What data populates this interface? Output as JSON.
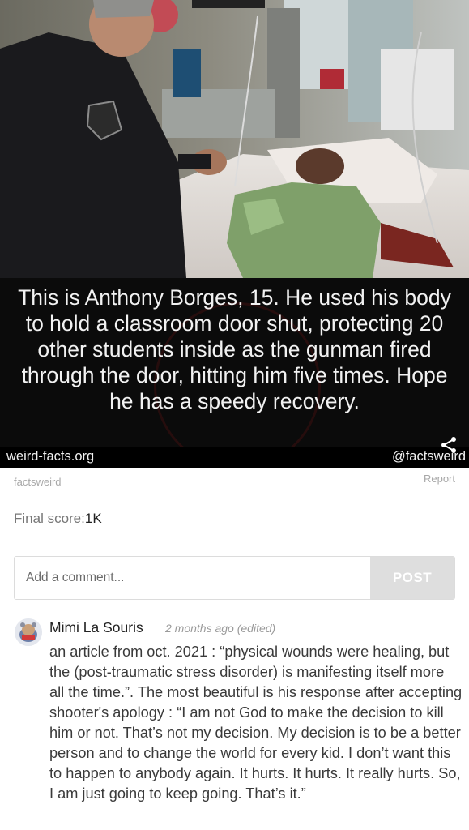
{
  "meme": {
    "caption": "This is Anthony Borges, 15. He used his body to hold a classroom door shut, protecting 20 other students inside as the gunman fired through the door, hitting him five times. Hope he has a speedy recovery.",
    "site": "weird-facts.org",
    "handle": "@factsweird",
    "share_icon": "share-icon"
  },
  "post": {
    "author": "factsweird",
    "report_label": "Report",
    "score_label": "Final score:",
    "score_value": "1K"
  },
  "comment_form": {
    "placeholder": "Add a comment...",
    "post_label": "POST"
  },
  "comments": [
    {
      "user": "Mimi La Souris",
      "time": "2 months ago (edited)",
      "text": "an article from oct. 2021 : “physical wounds were healing, but the (post-traumatic stress disorder) is manifesting itself more all the time.”. The most beautiful is his response after accepting shooter's apology : “I am not God to make the decision to kill him or not. That’s not my decision. My decision is to be a better person and to change the world for every kid. I don’t want this to happen to anybody again. It hurts. It hurts. It really hurts. So, I am just going to keep going. That’s it.”",
      "avatar_icon": "avatar"
    }
  ],
  "colors": {
    "post_button_bg": "#dedede",
    "muted_text": "#a8a8a8",
    "caption_bg": "#0b0b0b"
  }
}
